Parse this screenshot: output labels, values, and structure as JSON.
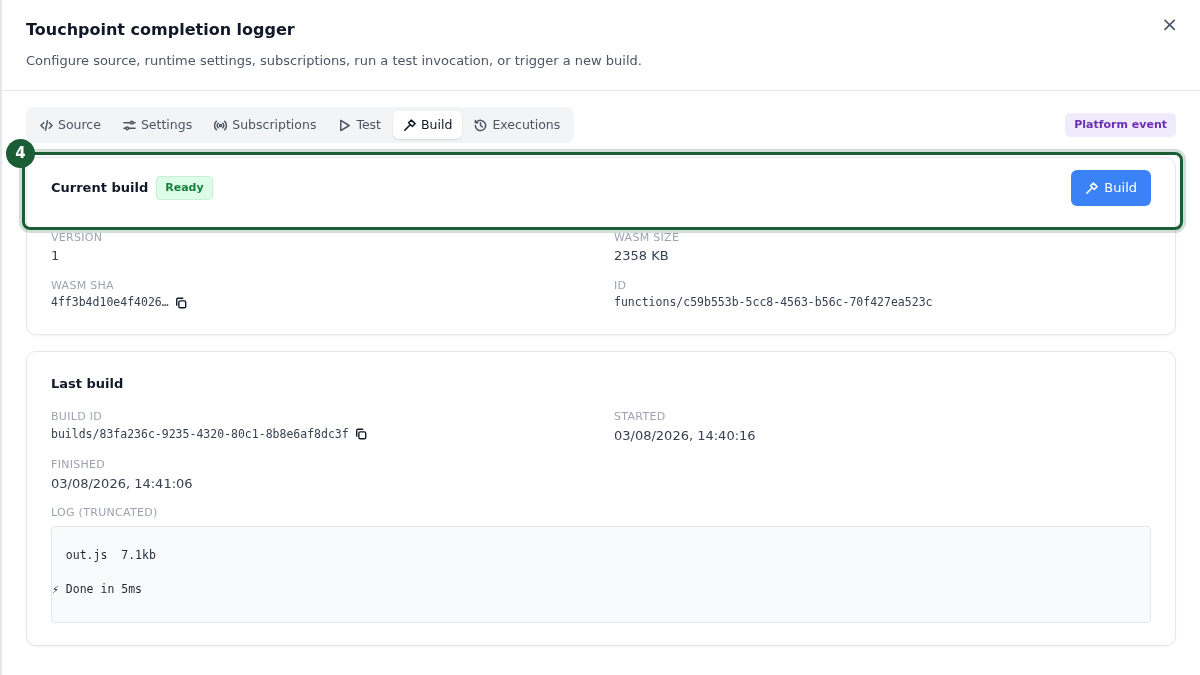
{
  "dialog": {
    "title": "Touchpoint completion logger",
    "subtitle": "Configure source, runtime settings, subscriptions, run a test invocation, or trigger a new build.",
    "close": "×"
  },
  "tabs": [
    {
      "label": "Source",
      "selected": false
    },
    {
      "label": "Settings",
      "selected": false
    },
    {
      "label": "Subscriptions",
      "selected": false
    },
    {
      "label": "Test",
      "selected": false
    },
    {
      "label": "Build",
      "selected": true
    },
    {
      "label": "Executions",
      "selected": false
    }
  ],
  "type_badge": "Platform event",
  "highlight": {
    "step": "4"
  },
  "current_build": {
    "title": "Current build",
    "status": "Ready",
    "button": "Build",
    "fields": [
      {
        "label": "VERSION",
        "value": "1",
        "kind": "text",
        "copyable": false
      },
      {
        "label": "WASM SIZE",
        "value": "2358 KB",
        "kind": "text",
        "copyable": false
      },
      {
        "label": "WASM SHA",
        "value": "4ff3b4d10e4f4026…",
        "kind": "mono",
        "copyable": true
      },
      {
        "label": "ID",
        "value": "functions/c59b553b-5cc8-4563-b56c-70f427ea523c",
        "kind": "mono",
        "copyable": false
      }
    ]
  },
  "last_build": {
    "title": "Last build",
    "fields": [
      {
        "label": "BUILD ID",
        "value": "builds/83fa236c-9235-4320-80c1-8b8e6af8dc3f",
        "kind": "mono",
        "copyable": true
      },
      {
        "label": "STARTED",
        "value": "03/08/2026, 14:40:16",
        "kind": "text",
        "copyable": false
      },
      {
        "label": "FINISHED",
        "value": "03/08/2026, 14:41:06",
        "kind": "text",
        "copyable": false
      }
    ],
    "log_label": "LOG (TRUNCATED)",
    "log_lines": [
      "  out.js  7.1kb",
      "⚡ Done in 5ms"
    ]
  }
}
